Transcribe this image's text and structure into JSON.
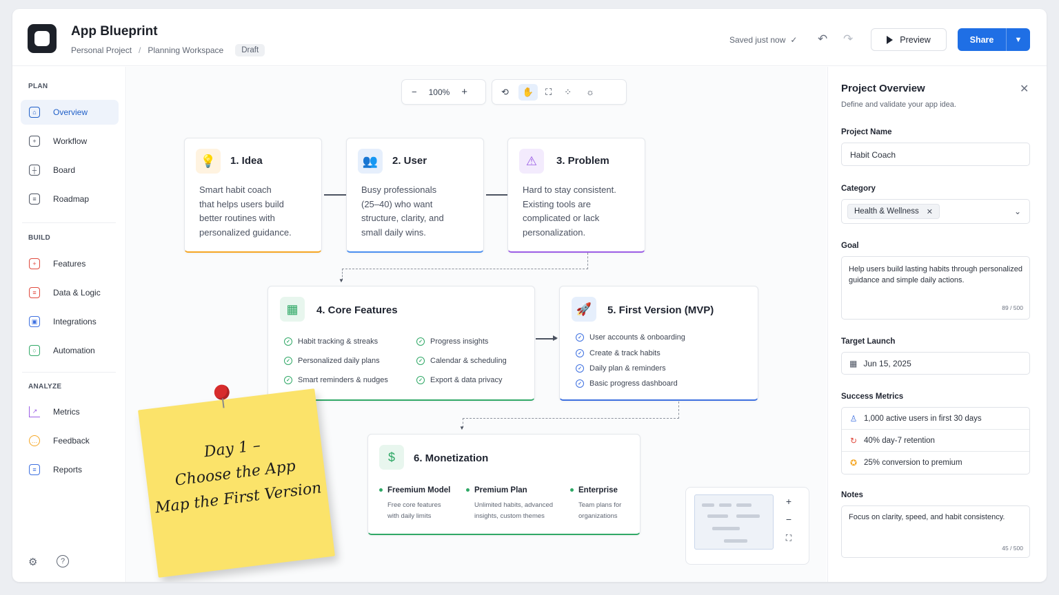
{
  "header": {
    "title": "App Blueprint",
    "breadcrumb": [
      "Personal Project",
      "Planning Workspace"
    ],
    "breadcrumb_sep": "/",
    "status_badge": "Draft",
    "saved_text": "Saved just now",
    "preview_label": "Preview",
    "share_label": "Share"
  },
  "sidebar": {
    "sections": [
      {
        "title": "PLAN",
        "items": [
          {
            "label": "Overview",
            "icon": "home-icon",
            "active": true
          },
          {
            "label": "Workflow",
            "icon": "workflow-icon"
          },
          {
            "label": "Board",
            "icon": "board-icon"
          },
          {
            "label": "Roadmap",
            "icon": "roadmap-icon"
          }
        ]
      },
      {
        "title": "BUILD",
        "items": [
          {
            "label": "Features",
            "icon": "features-icon"
          },
          {
            "label": "Data & Logic",
            "icon": "data-logic-icon"
          },
          {
            "label": "Integrations",
            "icon": "integrations-icon"
          },
          {
            "label": "Automation",
            "icon": "automation-icon"
          }
        ]
      },
      {
        "title": "ANALYZE",
        "items": [
          {
            "label": "Metrics",
            "icon": "metrics-icon"
          },
          {
            "label": "Feedback",
            "icon": "feedback-icon"
          },
          {
            "label": "Reports",
            "icon": "reports-icon"
          }
        ]
      }
    ]
  },
  "canvas": {
    "zoom": "100%",
    "cards": {
      "idea": {
        "title": "1. Idea",
        "text": [
          "Smart habit coach",
          "that helps users build",
          "better routines with",
          "personalized guidance."
        ],
        "accent": "#f5a623"
      },
      "user": {
        "title": "2. User",
        "text": [
          "Busy professionals",
          "(25–40) who want",
          "structure, clarity, and",
          "small daily wins."
        ],
        "accent": "#4a8ef0"
      },
      "problem": {
        "title": "3. Problem",
        "text": [
          "Hard to stay consistent.",
          "Existing tools are",
          "complicated or lack",
          "personalization."
        ],
        "accent": "#9b5de5"
      },
      "core": {
        "title": "4. Core Features",
        "features": [
          "Habit tracking & streaks",
          "Personalized daily plans",
          "Smart reminders & nudges",
          "Progress insights",
          "Calendar & scheduling",
          "Export & data privacy"
        ],
        "accent": "#2fa866"
      },
      "mvp": {
        "title": "5. First Version (MVP)",
        "features": [
          "User accounts & onboarding",
          "Create & track habits",
          "Daily plan & reminders",
          "Basic progress dashboard"
        ],
        "accent": "#3c6fe0"
      },
      "monetization": {
        "title": "6. Monetization",
        "plans": [
          {
            "name": "Freemium Model",
            "desc": [
              "Free core features",
              "with daily limits"
            ]
          },
          {
            "name": "Premium Plan",
            "desc": [
              "Unlimited habits, advanced",
              "insights, custom themes"
            ]
          },
          {
            "name": "Enterprise",
            "desc": [
              "Team plans for",
              "organizations"
            ]
          }
        ],
        "accent": "#2fa866"
      }
    },
    "sticky_note": [
      "Day 1 –",
      "Choose the App",
      "Map the First Version"
    ]
  },
  "panel": {
    "title": "Project Overview",
    "subtitle": "Define and validate your app idea.",
    "project_name_label": "Project Name",
    "project_name_value": "Habit Coach",
    "category_label": "Category",
    "category_value": "Health & Wellness",
    "goal_label": "Goal",
    "goal_value": "Help users build lasting habits through personalized guidance and simple daily actions.",
    "goal_count": "89 / 500",
    "target_label": "Target Launch",
    "target_value": "Jun 15, 2025",
    "metrics_label": "Success Metrics",
    "metrics": [
      {
        "text": "1,000 active users in first 30 days",
        "icon": "users-icon",
        "color": "#3c6fe0"
      },
      {
        "text": "40% day-7 retention",
        "icon": "retention-icon",
        "color": "#e0483c"
      },
      {
        "text": "25% conversion to premium",
        "icon": "star-icon",
        "color": "#f5a623"
      }
    ],
    "notes_label": "Notes",
    "notes_value": "Focus on clarity, speed, and habit consistency.",
    "notes_count": "45 / 500"
  }
}
